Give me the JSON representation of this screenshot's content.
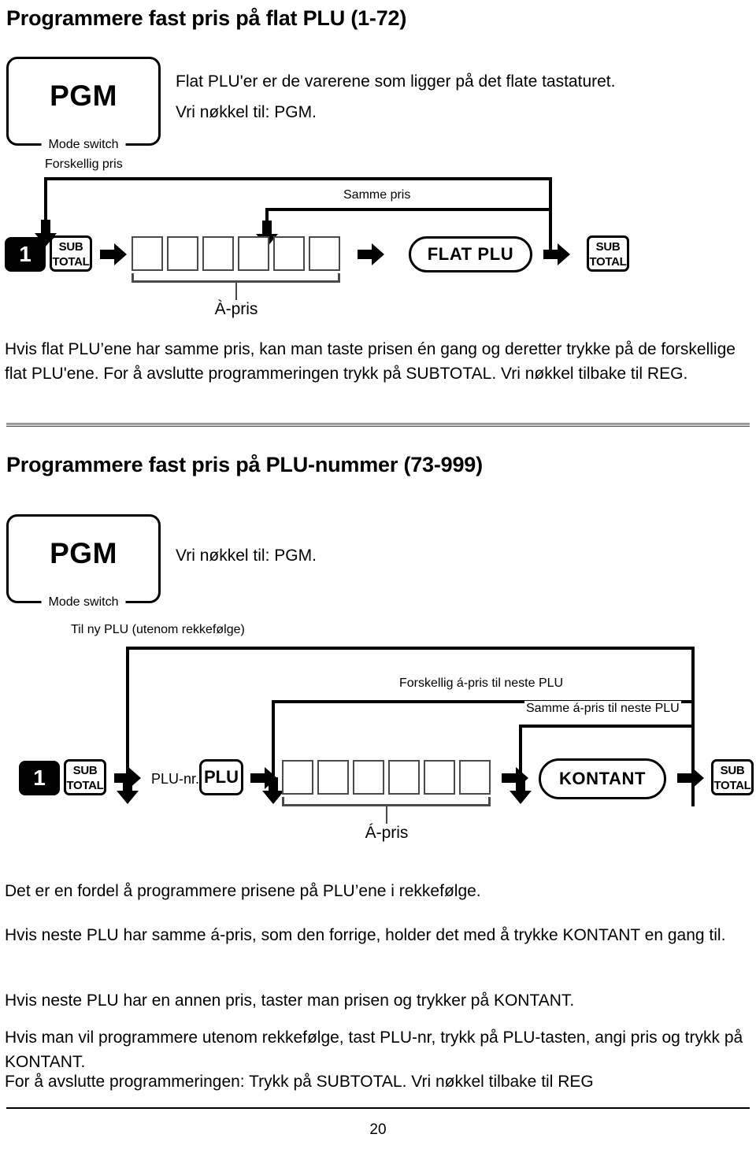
{
  "document": {
    "page_number": "20"
  },
  "sections": [
    {
      "title": "Programmere fast pris på flat PLU (1-72)",
      "mode_switch": {
        "value": "PGM",
        "legend": "Mode switch"
      },
      "intro_lines": [
        "Flat PLU'er er de varerene som ligger på det flate tastaturet.",
        "Vri nøkkel til: PGM."
      ],
      "diagram": {
        "labels": {
          "different_price": "Forskellig pris",
          "same_price": "Samme pris",
          "unit_price": "À-pris"
        },
        "keys": {
          "num": "1",
          "subtotal": "SUB\nTOTAL",
          "subtotal_line1": "SUB",
          "subtotal_line2": "TOTAL",
          "flat_plu": "FLAT PLU"
        },
        "entry_box_count": 6
      },
      "after_text": "Hvis flat PLU’ene har samme pris, kan man taste prisen én gang og deretter trykke på de forskellige flat PLU'ene. For å avslutte programmeringen trykk på SUBTOTAL. Vri nøkkel tilbake til REG."
    },
    {
      "title": "Programmere fast pris på PLU-nummer (73-999)",
      "mode_switch": {
        "value": "PGM",
        "legend": "Mode switch"
      },
      "intro_lines": [
        "Vri nøkkel til: PGM."
      ],
      "diagram": {
        "labels": {
          "new_plu": "Til ny PLU (utenom rekkefølge)",
          "different_price": "Forskellig á-pris til neste PLU",
          "same_price": "Samme á-pris til neste PLU",
          "unit_price": "Á-pris",
          "plu_nr": "PLU-nr."
        },
        "keys": {
          "num": "1",
          "subtotal_line1": "SUB",
          "subtotal_line2": "TOTAL",
          "plu": "PLU",
          "kontant": "KONTANT"
        },
        "entry_box_count": 6
      },
      "paragraphs": [
        "Det er en fordel å programmere prisene på PLU’ene i rekkefølge.",
        "Hvis neste PLU har samme á-pris, som den forrige, holder det med å trykke KONTANT en gang til.",
        "Hvis neste PLU har en annen pris, taster man prisen og trykker på KONTANT.",
        "Hvis man vil programmere utenom rekkefølge, tast PLU-nr, trykk på PLU-tasten, angi pris og trykk på KONTANT.",
        "For å avslutte programmeringen: Trykk på SUBTOTAL. Vri nøkkel tilbake til REG"
      ]
    }
  ]
}
